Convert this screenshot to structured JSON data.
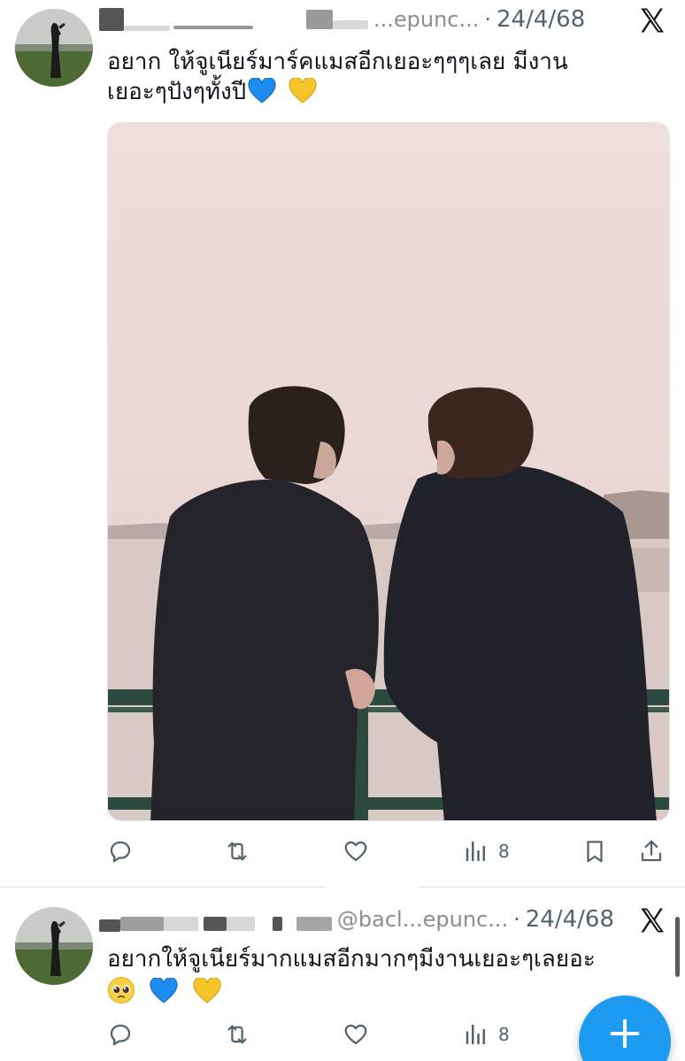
{
  "tweets": [
    {
      "handle": "...epunc...",
      "separator": "·",
      "date": "24/4/68",
      "text_line1": "อยาก ให้จูเนียร์มาร์คแมสอีกเยอะๆๆๆเลย มีงาน",
      "text_line2": "เยอะๆปังๆทั้งปี",
      "emojis": [
        "blue-heart",
        "yellow-heart"
      ],
      "metrics": {
        "views": "8"
      }
    },
    {
      "handle": "@bacl...epunc...",
      "separator": "·",
      "date": "24/4/68",
      "text_line1": "อยากให้จูเนียร์มากแมสอีกมากๆมีงานเยอะๆเลยอะ",
      "emojis": [
        "pleading-face",
        "blue-heart",
        "yellow-heart"
      ],
      "metrics": {
        "views": "8"
      }
    }
  ],
  "icons": {
    "reply": "reply-icon",
    "retweet": "retweet-icon",
    "like": "heart-icon",
    "views": "views-icon",
    "bookmark": "bookmark-icon",
    "share": "share-icon",
    "brand": "x-logo-icon",
    "compose": "plus-icon"
  },
  "colors": {
    "accent": "#1d9bf0",
    "text": "#0f1419",
    "secondary": "#536471",
    "blue_heart": "#1d8cf0",
    "yellow_heart": "#f7c52a"
  }
}
